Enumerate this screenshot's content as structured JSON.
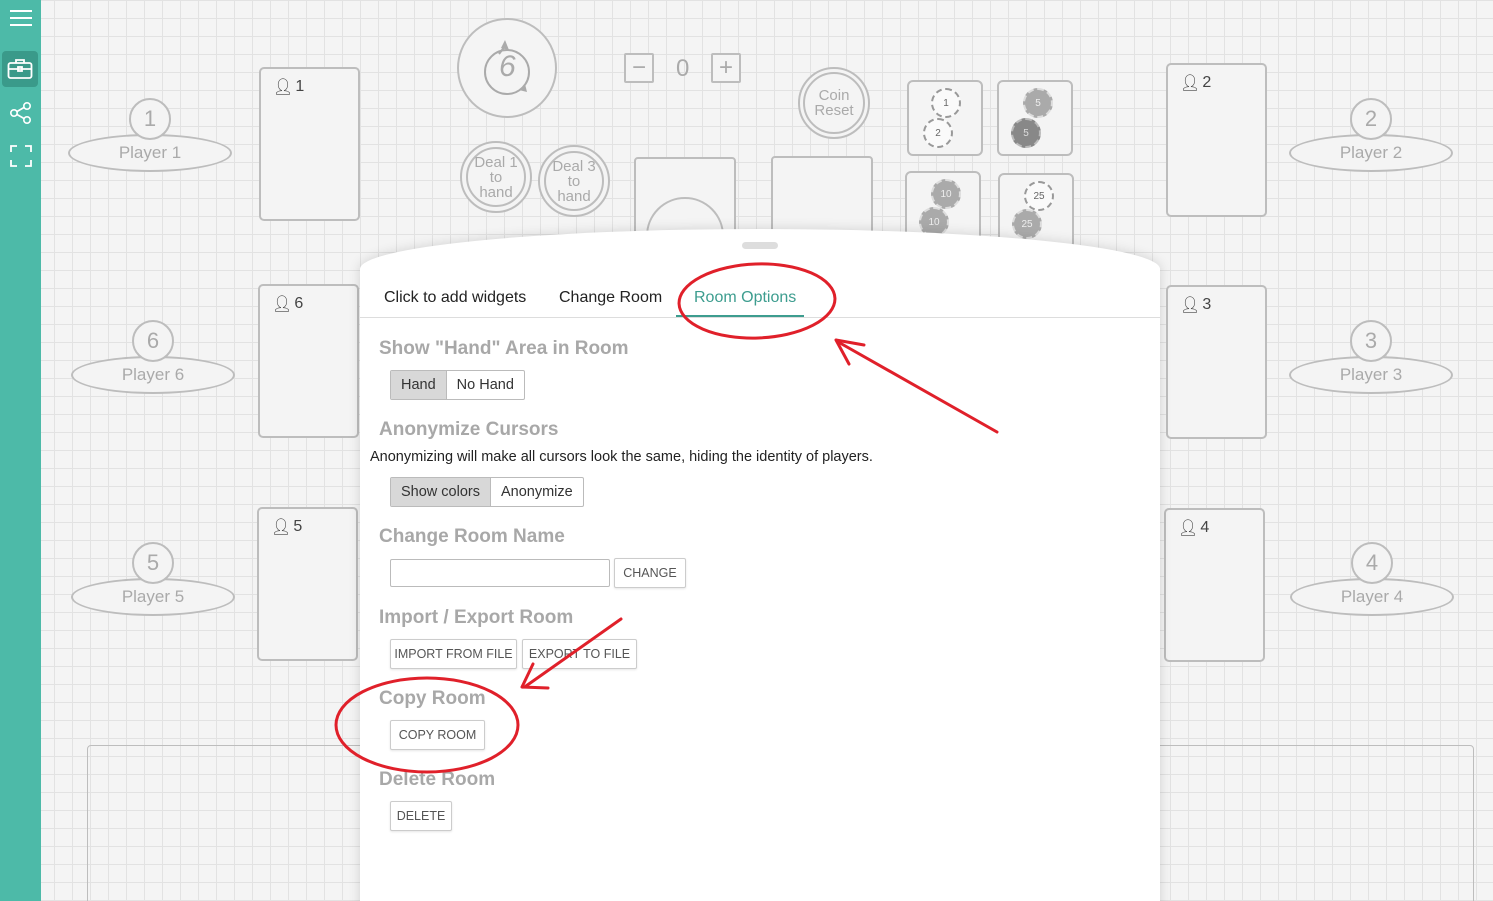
{
  "sidebar": {
    "items": [
      {
        "icon": "hamburger-menu-icon"
      },
      {
        "icon": "briefcase-icon"
      },
      {
        "icon": "share-icon"
      },
      {
        "icon": "fullscreen-icon"
      }
    ]
  },
  "table": {
    "seats": [
      {
        "number": "1",
        "name": "Player 1"
      },
      {
        "number": "2",
        "name": "Player 2"
      },
      {
        "number": "3",
        "name": "Player 3"
      },
      {
        "number": "4",
        "name": "Player 4"
      },
      {
        "number": "5",
        "name": "Player 5"
      },
      {
        "number": "6",
        "name": "Player 6"
      }
    ],
    "hands": [
      "1",
      "2",
      "3",
      "4",
      "5",
      "6"
    ],
    "dice_value": "6",
    "counter_value": "0",
    "deal1_label": "Deal 1 to hand",
    "deal3_label": "Deal 3 to hand",
    "coin_reset_label": "Coin Reset",
    "chips": [
      "1",
      "2",
      "5",
      "5",
      "10",
      "10",
      "25",
      "25"
    ]
  },
  "panel": {
    "tabs": [
      "Click to add widgets",
      "Change Room",
      "Room Options"
    ],
    "active_tab": "Room Options",
    "hand_section": {
      "title": "Show \"Hand\" Area in Room",
      "options": [
        "Hand",
        "No Hand"
      ],
      "selected": "Hand"
    },
    "cursor_section": {
      "title": "Anonymize Cursors",
      "description": "Anonymizing will make all cursors look the same, hiding the identity of players.",
      "options": [
        "Show colors",
        "Anonymize"
      ],
      "selected": "Show colors"
    },
    "name_section": {
      "title": "Change Room Name",
      "input_value": "",
      "button": "CHANGE"
    },
    "import_section": {
      "title": "Import / Export Room",
      "import_button": "IMPORT FROM FILE",
      "export_button": "EXPORT TO FILE"
    },
    "copy_section": {
      "title": "Copy Room",
      "button": "COPY ROOM"
    },
    "delete_section": {
      "title": "Delete Room",
      "button": "DELETE"
    }
  },
  "colors": {
    "sidebar": "#4dbaa8",
    "accent": "#3d9d8f",
    "annotation": "#e0202a"
  }
}
